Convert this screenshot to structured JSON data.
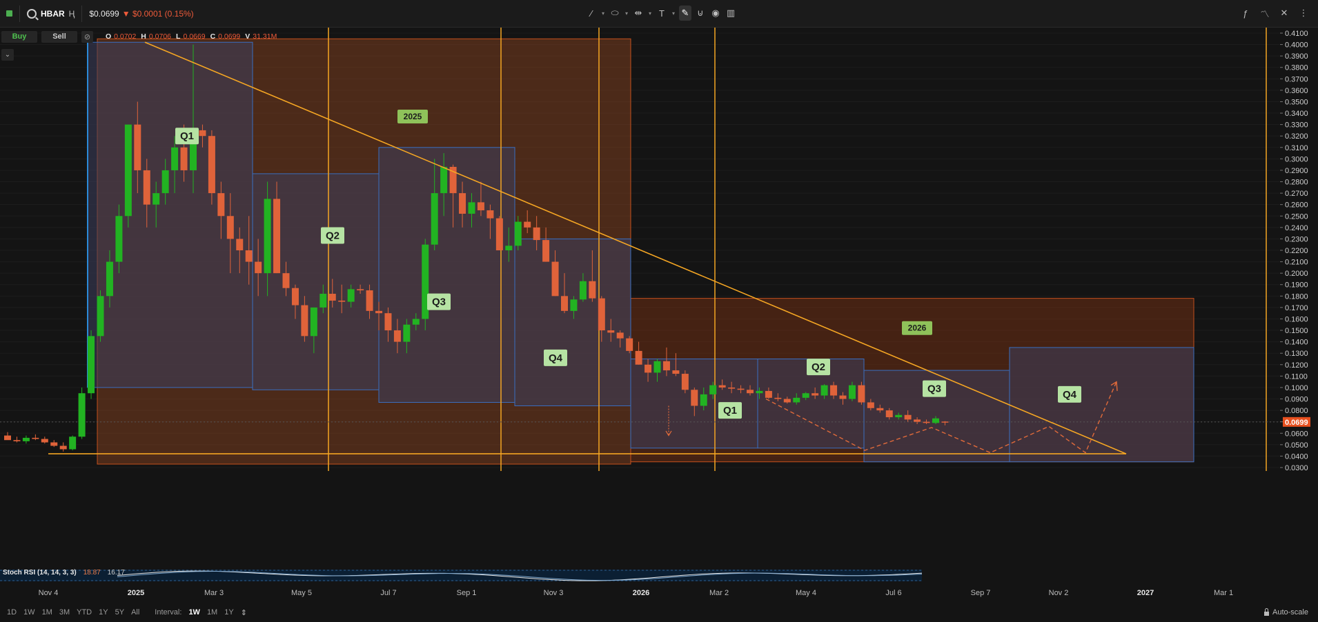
{
  "toolbar": {
    "symbol": "HBAR",
    "price": "$0.0699",
    "change": "▼ $0.0001 (0.15%)",
    "tool_icons": [
      "pen-icon",
      "ellipse-icon",
      "measure-icon",
      "text-icon",
      "brush-icon",
      "magnet-icon",
      "eye-icon",
      "trash-icon"
    ]
  },
  "trade": {
    "buy_label": "Buy",
    "sell_label": "Sell"
  },
  "ohlc": {
    "o_label": "O",
    "o": "0.0702",
    "h_label": "H",
    "h": "0.0706",
    "l_label": "L",
    "l": "0.0669",
    "c_label": "C",
    "c": "0.0699",
    "v_label": "V",
    "v": "31.31M"
  },
  "price_axis": {
    "ticks": [
      "0.4100",
      "0.4000",
      "0.3900",
      "0.3800",
      "0.3700",
      "0.3600",
      "0.3500",
      "0.3400",
      "0.3300",
      "0.3200",
      "0.3100",
      "0.3000",
      "0.2900",
      "0.2800",
      "0.2700",
      "0.2600",
      "0.2500",
      "0.2400",
      "0.2300",
      "0.2200",
      "0.2100",
      "0.2000",
      "0.1900",
      "0.1800",
      "0.1700",
      "0.1600",
      "0.1500",
      "0.1400",
      "0.1300",
      "0.1200",
      "0.1100",
      "0.1000",
      "0.0900",
      "0.0800",
      "0.0700",
      "0.0600",
      "0.0500",
      "0.0400",
      "0.0300"
    ],
    "current_price_tag": "0.0699"
  },
  "time_axis": [
    {
      "label": "Nov 4",
      "bold": false
    },
    {
      "label": "2025",
      "bold": true
    },
    {
      "label": "Mar 3",
      "bold": false
    },
    {
      "label": "May 5",
      "bold": false
    },
    {
      "label": "Jul 7",
      "bold": false
    },
    {
      "label": "Sep 1",
      "bold": false
    },
    {
      "label": "Nov 3",
      "bold": false
    },
    {
      "label": "2026",
      "bold": true
    },
    {
      "label": "Mar 2",
      "bold": false
    },
    {
      "label": "May 4",
      "bold": false
    },
    {
      "label": "Jul 6",
      "bold": false
    },
    {
      "label": "Sep 7",
      "bold": false
    },
    {
      "label": "Nov 2",
      "bold": false
    },
    {
      "label": "2027",
      "bold": true
    },
    {
      "label": "Mar 1",
      "bold": false
    }
  ],
  "annotations": {
    "year_labels": [
      "2025",
      "2026"
    ],
    "quarter_labels": [
      "Q1",
      "Q2",
      "Q3",
      "Q4",
      "Q1",
      "Q2",
      "Q3",
      "Q4"
    ]
  },
  "indicator": {
    "name": "Stoch RSI (14, 14, 3, 3)",
    "k_value": "18.87",
    "d_value": "16.17"
  },
  "bottom": {
    "ranges": [
      "1D",
      "1W",
      "1M",
      "3M",
      "YTD",
      "1Y",
      "5Y",
      "All"
    ],
    "interval_label": "Interval:",
    "intervals": [
      "1W",
      "1M",
      "1Y"
    ],
    "active_interval": "1W",
    "autoscale_label": "Auto-scale"
  },
  "colors": {
    "up": "#22b322",
    "down": "#e0633a",
    "accent_line": "#f5a623",
    "quarter_label_bg": "#b6e3a3",
    "price_tag": "#e8501f"
  },
  "chart_data": {
    "type": "candlestick",
    "interval": "1W",
    "ylim": [
      0.03,
      0.41
    ],
    "x_axis_labels": [
      "Nov 4",
      "2025",
      "Mar 3",
      "May 5",
      "Jul 7",
      "Sep 1",
      "Nov 3",
      "2026",
      "Mar 2",
      "May 4",
      "Jul 6",
      "Sep 7",
      "Nov 2",
      "2027",
      "Mar 1"
    ],
    "candles": [
      [
        0.058,
        0.061,
        0.055,
        0.054
      ],
      [
        0.054,
        0.057,
        0.052,
        0.053
      ],
      [
        0.053,
        0.058,
        0.051,
        0.056
      ],
      [
        0.056,
        0.059,
        0.054,
        0.055
      ],
      [
        0.055,
        0.057,
        0.051,
        0.052
      ],
      [
        0.052,
        0.054,
        0.048,
        0.049
      ],
      [
        0.049,
        0.052,
        0.044,
        0.046
      ],
      [
        0.046,
        0.058,
        0.045,
        0.057
      ],
      [
        0.057,
        0.1,
        0.055,
        0.095
      ],
      [
        0.095,
        0.15,
        0.09,
        0.145
      ],
      [
        0.145,
        0.185,
        0.14,
        0.18
      ],
      [
        0.18,
        0.22,
        0.17,
        0.21
      ],
      [
        0.21,
        0.26,
        0.2,
        0.25
      ],
      [
        0.25,
        0.33,
        0.24,
        0.33
      ],
      [
        0.33,
        0.35,
        0.27,
        0.29
      ],
      [
        0.29,
        0.3,
        0.24,
        0.26
      ],
      [
        0.26,
        0.28,
        0.24,
        0.27
      ],
      [
        0.27,
        0.3,
        0.26,
        0.29
      ],
      [
        0.29,
        0.32,
        0.27,
        0.31
      ],
      [
        0.31,
        0.33,
        0.28,
        0.29
      ],
      [
        0.29,
        0.4,
        0.27,
        0.325
      ],
      [
        0.325,
        0.33,
        0.31,
        0.32
      ],
      [
        0.32,
        0.325,
        0.26,
        0.27
      ],
      [
        0.27,
        0.28,
        0.23,
        0.25
      ],
      [
        0.25,
        0.27,
        0.2,
        0.23
      ],
      [
        0.23,
        0.24,
        0.2,
        0.22
      ],
      [
        0.22,
        0.25,
        0.19,
        0.21
      ],
      [
        0.21,
        0.23,
        0.18,
        0.2
      ],
      [
        0.2,
        0.28,
        0.18,
        0.265
      ],
      [
        0.265,
        0.28,
        0.2,
        0.2
      ],
      [
        0.2,
        0.21,
        0.18,
        0.187
      ],
      [
        0.187,
        0.19,
        0.16,
        0.172
      ],
      [
        0.172,
        0.18,
        0.14,
        0.145
      ],
      [
        0.145,
        0.17,
        0.13,
        0.17
      ],
      [
        0.17,
        0.19,
        0.165,
        0.182
      ],
      [
        0.182,
        0.195,
        0.17,
        0.176
      ],
      [
        0.176,
        0.19,
        0.165,
        0.175
      ],
      [
        0.175,
        0.19,
        0.17,
        0.186
      ],
      [
        0.186,
        0.19,
        0.182,
        0.185
      ],
      [
        0.185,
        0.19,
        0.16,
        0.167
      ],
      [
        0.167,
        0.175,
        0.15,
        0.165
      ],
      [
        0.165,
        0.17,
        0.14,
        0.15
      ],
      [
        0.15,
        0.16,
        0.13,
        0.14
      ],
      [
        0.14,
        0.16,
        0.13,
        0.155
      ],
      [
        0.155,
        0.165,
        0.15,
        0.16
      ],
      [
        0.16,
        0.23,
        0.15,
        0.225
      ],
      [
        0.225,
        0.3,
        0.22,
        0.27
      ],
      [
        0.27,
        0.305,
        0.25,
        0.293
      ],
      [
        0.293,
        0.295,
        0.24,
        0.27
      ],
      [
        0.27,
        0.28,
        0.24,
        0.252
      ],
      [
        0.252,
        0.27,
        0.24,
        0.262
      ],
      [
        0.262,
        0.28,
        0.25,
        0.255
      ],
      [
        0.255,
        0.26,
        0.23,
        0.248
      ],
      [
        0.248,
        0.25,
        0.22,
        0.22
      ],
      [
        0.22,
        0.24,
        0.21,
        0.224
      ],
      [
        0.224,
        0.25,
        0.22,
        0.245
      ],
      [
        0.245,
        0.255,
        0.235,
        0.24
      ],
      [
        0.24,
        0.25,
        0.22,
        0.229
      ],
      [
        0.229,
        0.24,
        0.21,
        0.21
      ],
      [
        0.21,
        0.22,
        0.18,
        0.18
      ],
      [
        0.18,
        0.2,
        0.165,
        0.167
      ],
      [
        0.167,
        0.18,
        0.16,
        0.177
      ],
      [
        0.177,
        0.2,
        0.175,
        0.193
      ],
      [
        0.193,
        0.22,
        0.175,
        0.178
      ],
      [
        0.178,
        0.18,
        0.14,
        0.15
      ],
      [
        0.15,
        0.16,
        0.14,
        0.148
      ],
      [
        0.148,
        0.15,
        0.135,
        0.143
      ],
      [
        0.143,
        0.145,
        0.13,
        0.132
      ],
      [
        0.132,
        0.14,
        0.12,
        0.12
      ],
      [
        0.12,
        0.125,
        0.105,
        0.113
      ],
      [
        0.113,
        0.125,
        0.105,
        0.123
      ],
      [
        0.123,
        0.135,
        0.11,
        0.115
      ],
      [
        0.115,
        0.13,
        0.11,
        0.112
      ],
      [
        0.112,
        0.115,
        0.095,
        0.098
      ],
      [
        0.098,
        0.1,
        0.075,
        0.084
      ],
      [
        0.084,
        0.1,
        0.08,
        0.094
      ],
      [
        0.094,
        0.105,
        0.09,
        0.102
      ],
      [
        0.102,
        0.107,
        0.098,
        0.1
      ],
      [
        0.1,
        0.105,
        0.095,
        0.099
      ],
      [
        0.099,
        0.102,
        0.095,
        0.098
      ],
      [
        0.098,
        0.102,
        0.093,
        0.095
      ],
      [
        0.095,
        0.1,
        0.09,
        0.097
      ],
      [
        0.097,
        0.1,
        0.09,
        0.091
      ],
      [
        0.091,
        0.095,
        0.088,
        0.09
      ],
      [
        0.09,
        0.092,
        0.086,
        0.087
      ],
      [
        0.087,
        0.095,
        0.085,
        0.091
      ],
      [
        0.091,
        0.096,
        0.089,
        0.095
      ],
      [
        0.095,
        0.1,
        0.09,
        0.093
      ],
      [
        0.093,
        0.103,
        0.09,
        0.102
      ],
      [
        0.102,
        0.105,
        0.09,
        0.093
      ],
      [
        0.093,
        0.096,
        0.085,
        0.09
      ],
      [
        0.09,
        0.105,
        0.088,
        0.102
      ],
      [
        0.102,
        0.105,
        0.085,
        0.087
      ],
      [
        0.087,
        0.09,
        0.08,
        0.082
      ],
      [
        0.082,
        0.085,
        0.078,
        0.08
      ],
      [
        0.08,
        0.082,
        0.072,
        0.074
      ],
      [
        0.074,
        0.078,
        0.072,
        0.076
      ],
      [
        0.076,
        0.08,
        0.07,
        0.072
      ],
      [
        0.072,
        0.074,
        0.068,
        0.07
      ],
      [
        0.07,
        0.072,
        0.068,
        0.069
      ],
      [
        0.069,
        0.075,
        0.068,
        0.073
      ],
      [
        0.0702,
        0.0706,
        0.0669,
        0.0699
      ]
    ],
    "year_zones": [
      {
        "label": "2025",
        "from": "Jan 2025",
        "to": "Dec 2025",
        "low": 0.033,
        "high": 0.405
      },
      {
        "label": "2026",
        "from": "Dec 2025",
        "to": "Jan 2027",
        "low": 0.035,
        "high": 0.178
      }
    ],
    "quarter_zones": [
      {
        "label": "Q1",
        "low": 0.1,
        "high": 0.402
      },
      {
        "label": "Q2",
        "low": 0.098,
        "high": 0.287
      },
      {
        "label": "Q3",
        "low": 0.087,
        "high": 0.31
      },
      {
        "label": "Q4",
        "low": 0.084,
        "high": 0.23
      },
      {
        "label": "Q1",
        "low": 0.047,
        "high": 0.125
      },
      {
        "label": "Q2",
        "low": 0.047,
        "high": 0.125
      },
      {
        "label": "Q3",
        "low": 0.035,
        "high": 0.115
      },
      {
        "label": "Q4",
        "low": 0.035,
        "high": 0.135
      }
    ],
    "downtrend_line": {
      "from": 0.402,
      "to": 0.042
    },
    "support_line": 0.042,
    "projection_path": [
      0.09,
      0.045,
      0.065,
      0.043,
      0.066,
      0.043,
      0.105
    ],
    "stoch_rsi": {
      "k": 18.87,
      "d": 16.17
    }
  }
}
